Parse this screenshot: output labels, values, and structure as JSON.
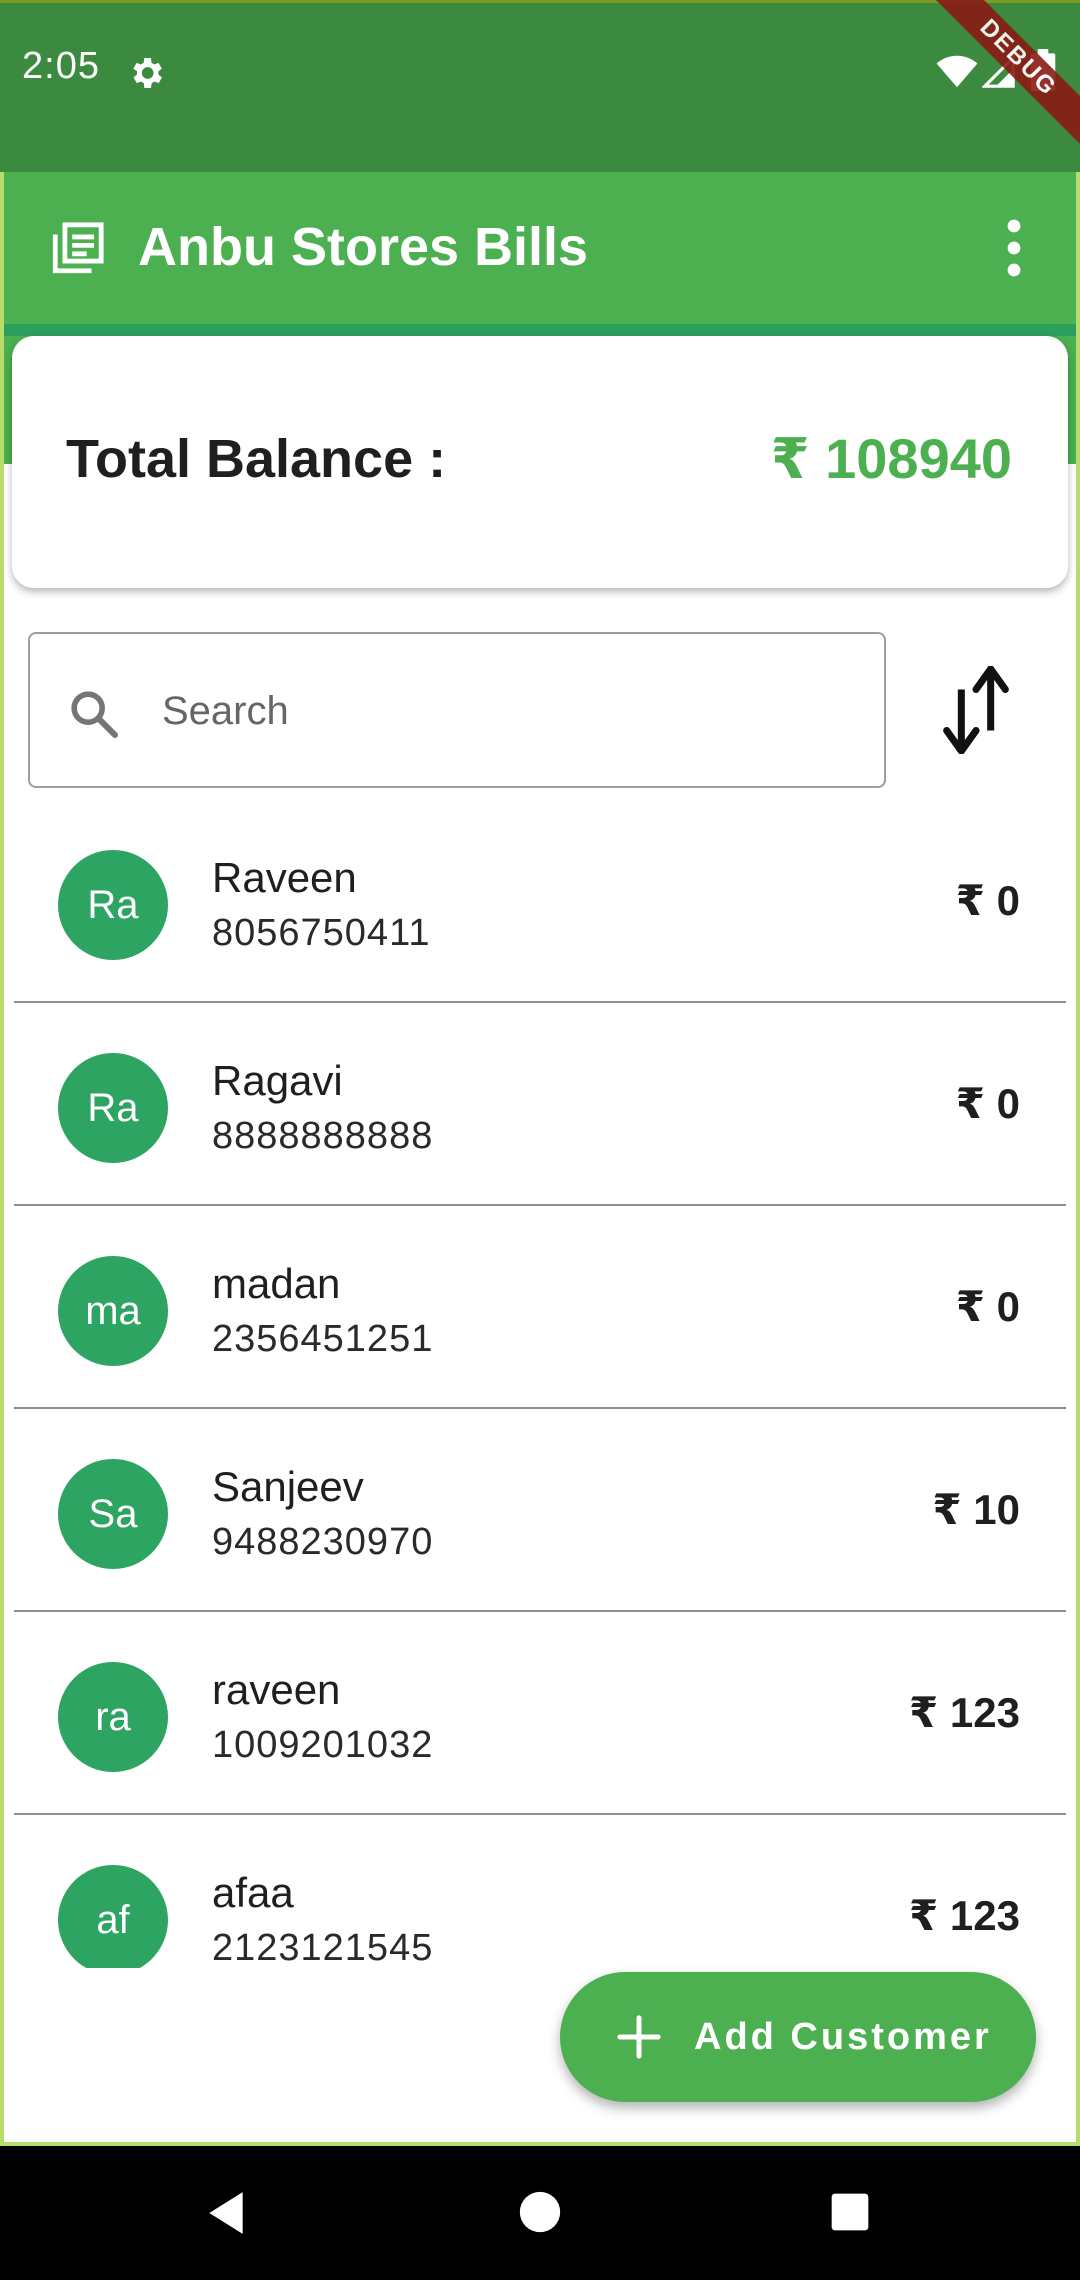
{
  "status_bar": {
    "time": "2:05",
    "debug_label": "DEBUG"
  },
  "app_bar": {
    "title": "Anbu Stores Bills"
  },
  "balance": {
    "label": "Total Balance :",
    "value": "₹ 108940"
  },
  "search": {
    "placeholder": "Search"
  },
  "customers": [
    {
      "initials": "Ra",
      "name": "Raveen",
      "phone": "8056750411",
      "balance": "₹ 0"
    },
    {
      "initials": "Ra",
      "name": "Ragavi",
      "phone": "8888888888",
      "balance": "₹ 0"
    },
    {
      "initials": "ma",
      "name": "madan",
      "phone": "2356451251",
      "balance": "₹ 0"
    },
    {
      "initials": "Sa",
      "name": "Sanjeev",
      "phone": "9488230970",
      "balance": "₹ 10"
    },
    {
      "initials": "ra",
      "name": "raveen",
      "phone": "1009201032",
      "balance": "₹ 123"
    },
    {
      "initials": "af",
      "name": "afaa",
      "phone": "2123121545",
      "balance": "₹ 123"
    }
  ],
  "fab": {
    "label": "Add Customer"
  },
  "colors": {
    "primary": "#4caf50",
    "status_bar": "#3b8a3f",
    "avatar": "#2ea463",
    "balance_value": "#4caf50"
  },
  "icons": {
    "app_bar": "receipt-list-icon",
    "menu": "more-vert-icon",
    "search": "search-icon",
    "sort": "swap-vert-icon",
    "fab": "plus-icon"
  }
}
